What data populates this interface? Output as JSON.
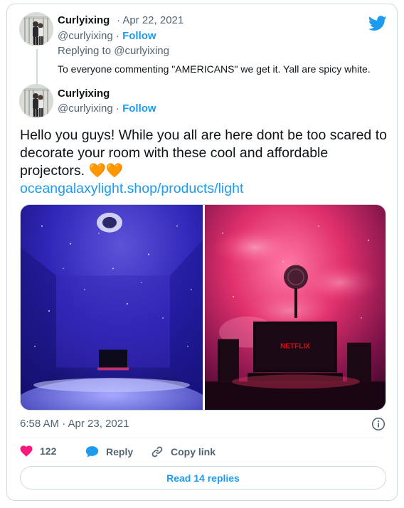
{
  "parent_tweet": {
    "display_name": "Curlyixing",
    "date": "· Apr 22, 2021",
    "handle": "@curlyixing",
    "follow_sep": "·",
    "follow_label": "Follow",
    "replying_to": "Replying to @curlyixing",
    "text": "To everyone commenting \"AMERICANS\" we get it. Yall are spicy white."
  },
  "main_tweet": {
    "display_name": "Curlyixing",
    "handle": "@curlyixing",
    "follow_sep": "·",
    "follow_label": "Follow",
    "text": "Hello you guys! While you all are here dont be too scared to decorate your room with these cool and affordable projectors.",
    "emoji": "🧡🧡",
    "link": "oceangalaxylight.shop/products/light",
    "media_left_label": "",
    "media_right_label": "NETFLIX",
    "timestamp": "6:58 AM · Apr 23, 2021"
  },
  "actions": {
    "like_count": "122",
    "reply_label": "Reply",
    "copy_link_label": "Copy link"
  },
  "read_replies_label": "Read 14 replies",
  "icons": {
    "brand": "twitter-bird-icon",
    "info": "info-icon",
    "like": "heart-icon",
    "reply": "reply-bubble-icon",
    "copy": "link-icon"
  },
  "colors": {
    "accent": "#1d9bf0",
    "like": "#f91880",
    "muted": "#536471",
    "heart_emoji": "#f4900c"
  }
}
